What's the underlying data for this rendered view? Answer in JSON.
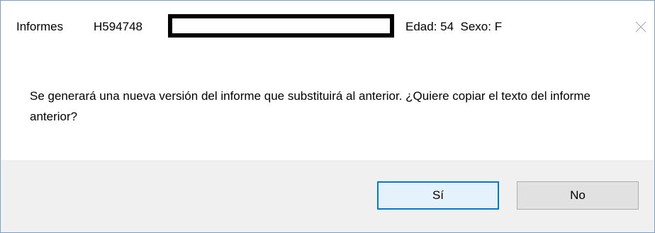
{
  "dialog": {
    "title_app": "Informes",
    "title_patient_id": "H594748",
    "title_age_sex": "Edad: 54  Sexo: F",
    "message": "Se generará una nueva versión del informe que substituirá al anterior. ¿Quiere copiar el texto del informe anterior?",
    "close_icon": "close-icon",
    "buttons": {
      "yes_label": "Sí",
      "no_label": "No"
    },
    "colors": {
      "border": "#7a9cc6",
      "default_button_border": "#0078d7",
      "footer_background": "#f0f0f0"
    }
  }
}
